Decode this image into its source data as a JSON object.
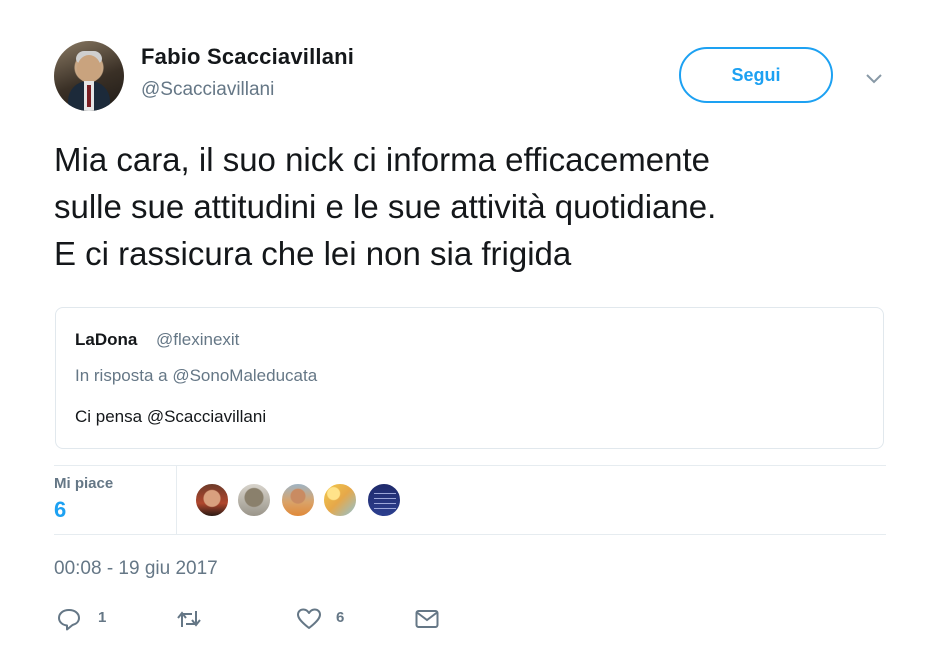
{
  "author": {
    "name": "Fabio Scacciavillani",
    "handle": "@Scacciavillani",
    "follow_label": "Segui"
  },
  "tweet": {
    "text": "Mia cara, il suo nick ci informa efficacemente\nsulle sue attitudini e le sue attività quotidiane.\nE ci rassicura che lei non sia frigida"
  },
  "quoted": {
    "name": "LaDona",
    "handle": "@flexinexit",
    "reply_to": "In risposta a @SonoMaleducata",
    "text": "Ci pensa @Scacciavillani"
  },
  "stats": {
    "likes_label": "Mi piace",
    "likes_count": "6"
  },
  "timestamp": "00:08 - 19 giu 2017",
  "actions": {
    "reply_count": "1",
    "like_count": "6"
  },
  "colors": {
    "accent": "#1da1f2",
    "secondary_text": "#657786",
    "border": "#e1e8ed"
  },
  "icons": [
    "caret-down-icon",
    "reply-icon",
    "retweet-icon",
    "like-icon",
    "dm-icon"
  ]
}
